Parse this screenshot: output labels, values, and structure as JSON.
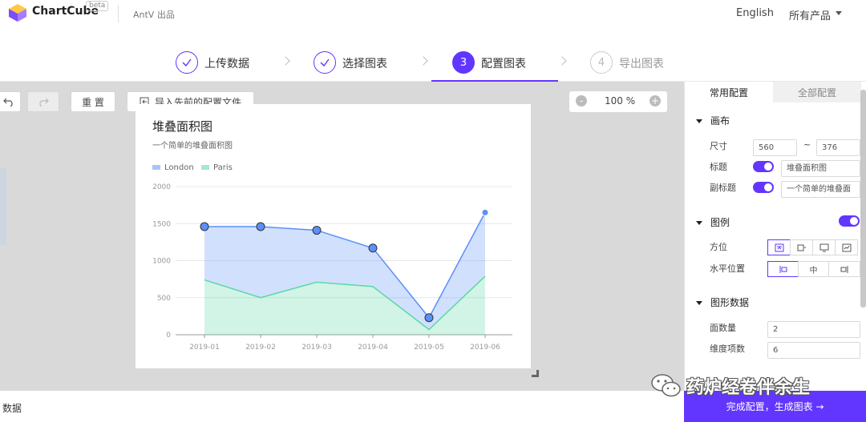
{
  "header": {
    "brand": "ChartCube",
    "beta": "beta",
    "org": "AntV 出品",
    "language": "English",
    "products": "所有产品"
  },
  "steps": [
    {
      "label": "上传数据",
      "state": "done"
    },
    {
      "label": "选择图表",
      "state": "done"
    },
    {
      "num": "3",
      "label": "配置图表",
      "state": "active"
    },
    {
      "num": "4",
      "label": "导出图表",
      "state": "todo"
    }
  ],
  "toolbar": {
    "undo_icon": "undo-icon",
    "redo_icon": "redo-icon",
    "reset_label": "重 置",
    "import_label": "导入先前的配置文件",
    "zoom_minus": "-",
    "zoom_plus": "+",
    "zoom_value": "100 %"
  },
  "chart_data": {
    "type": "area",
    "stacked": true,
    "title": "堆叠面积图",
    "subtitle": "一个简单的堆叠面积图",
    "categories": [
      "2019-01",
      "2019-02",
      "2019-03",
      "2019-04",
      "2019-05",
      "2019-06"
    ],
    "yticks": [
      "0",
      "500",
      "1000",
      "1500",
      "2000"
    ],
    "ylim": [
      0,
      2000
    ],
    "legend_position": "top-left",
    "series": [
      {
        "name": "London",
        "color": "#5b8ff9",
        "values": [
          720,
          960,
          700,
          520,
          160,
          860
        ]
      },
      {
        "name": "Paris",
        "color": "#5ad8a6",
        "values": [
          740,
          500,
          710,
          650,
          70,
          790
        ]
      }
    ]
  },
  "panel": {
    "tabs": [
      "常用配置",
      "全部配置"
    ],
    "canvas": {
      "section": "画布",
      "size_label": "尺寸",
      "width": "560",
      "tilde": "~",
      "height": "376",
      "title_label": "标题",
      "title_value": "堆叠面积图",
      "subtitle_label": "副标题",
      "subtitle_value": "一个简单的堆叠面"
    },
    "legend": {
      "section": "图例",
      "position_label": "方位",
      "hpos_label": "水平位置",
      "hpos_middle": "中"
    },
    "shape_data": {
      "section": "图形数据",
      "area_count_label": "面数量",
      "area_count": "2",
      "dimension_label": "维度项数",
      "dimension": "6"
    }
  },
  "bottom": {
    "data_label": "数据",
    "finish_label": "完成配置，生成图表 →"
  },
  "watermark": {
    "text": "药炉经卷伴余生"
  },
  "colors": {
    "accent": "#6236ff"
  }
}
